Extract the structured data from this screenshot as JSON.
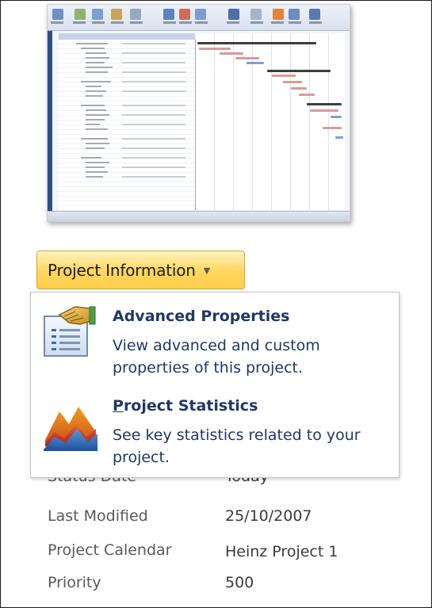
{
  "project_info_button": {
    "label": "Project Information",
    "caret_icon": "dropdown-arrow"
  },
  "menu": {
    "items": [
      {
        "title": "Advanced Properties",
        "description": "View advanced and custom properties of this project.",
        "icon": "advanced-properties-icon"
      },
      {
        "title": "Project Statistics",
        "description": "See key statistics related to your project.",
        "icon": "project-statistics-icon"
      }
    ]
  },
  "properties": {
    "rows": [
      {
        "label": "Status Date",
        "value": "Today"
      },
      {
        "label": "Last Modified",
        "value": "25/10/2007"
      },
      {
        "label": "Project Calendar",
        "value": "Heinz Project 1"
      },
      {
        "label": "Priority",
        "value": "500"
      }
    ]
  },
  "thumbnail": {
    "icon": "project-preview-thumbnail"
  },
  "colors": {
    "button_gradient_top": "#fff3c0",
    "button_gradient_bottom": "#ffcf4a",
    "menu_text": "#1f3864",
    "property_label": "#595959"
  }
}
